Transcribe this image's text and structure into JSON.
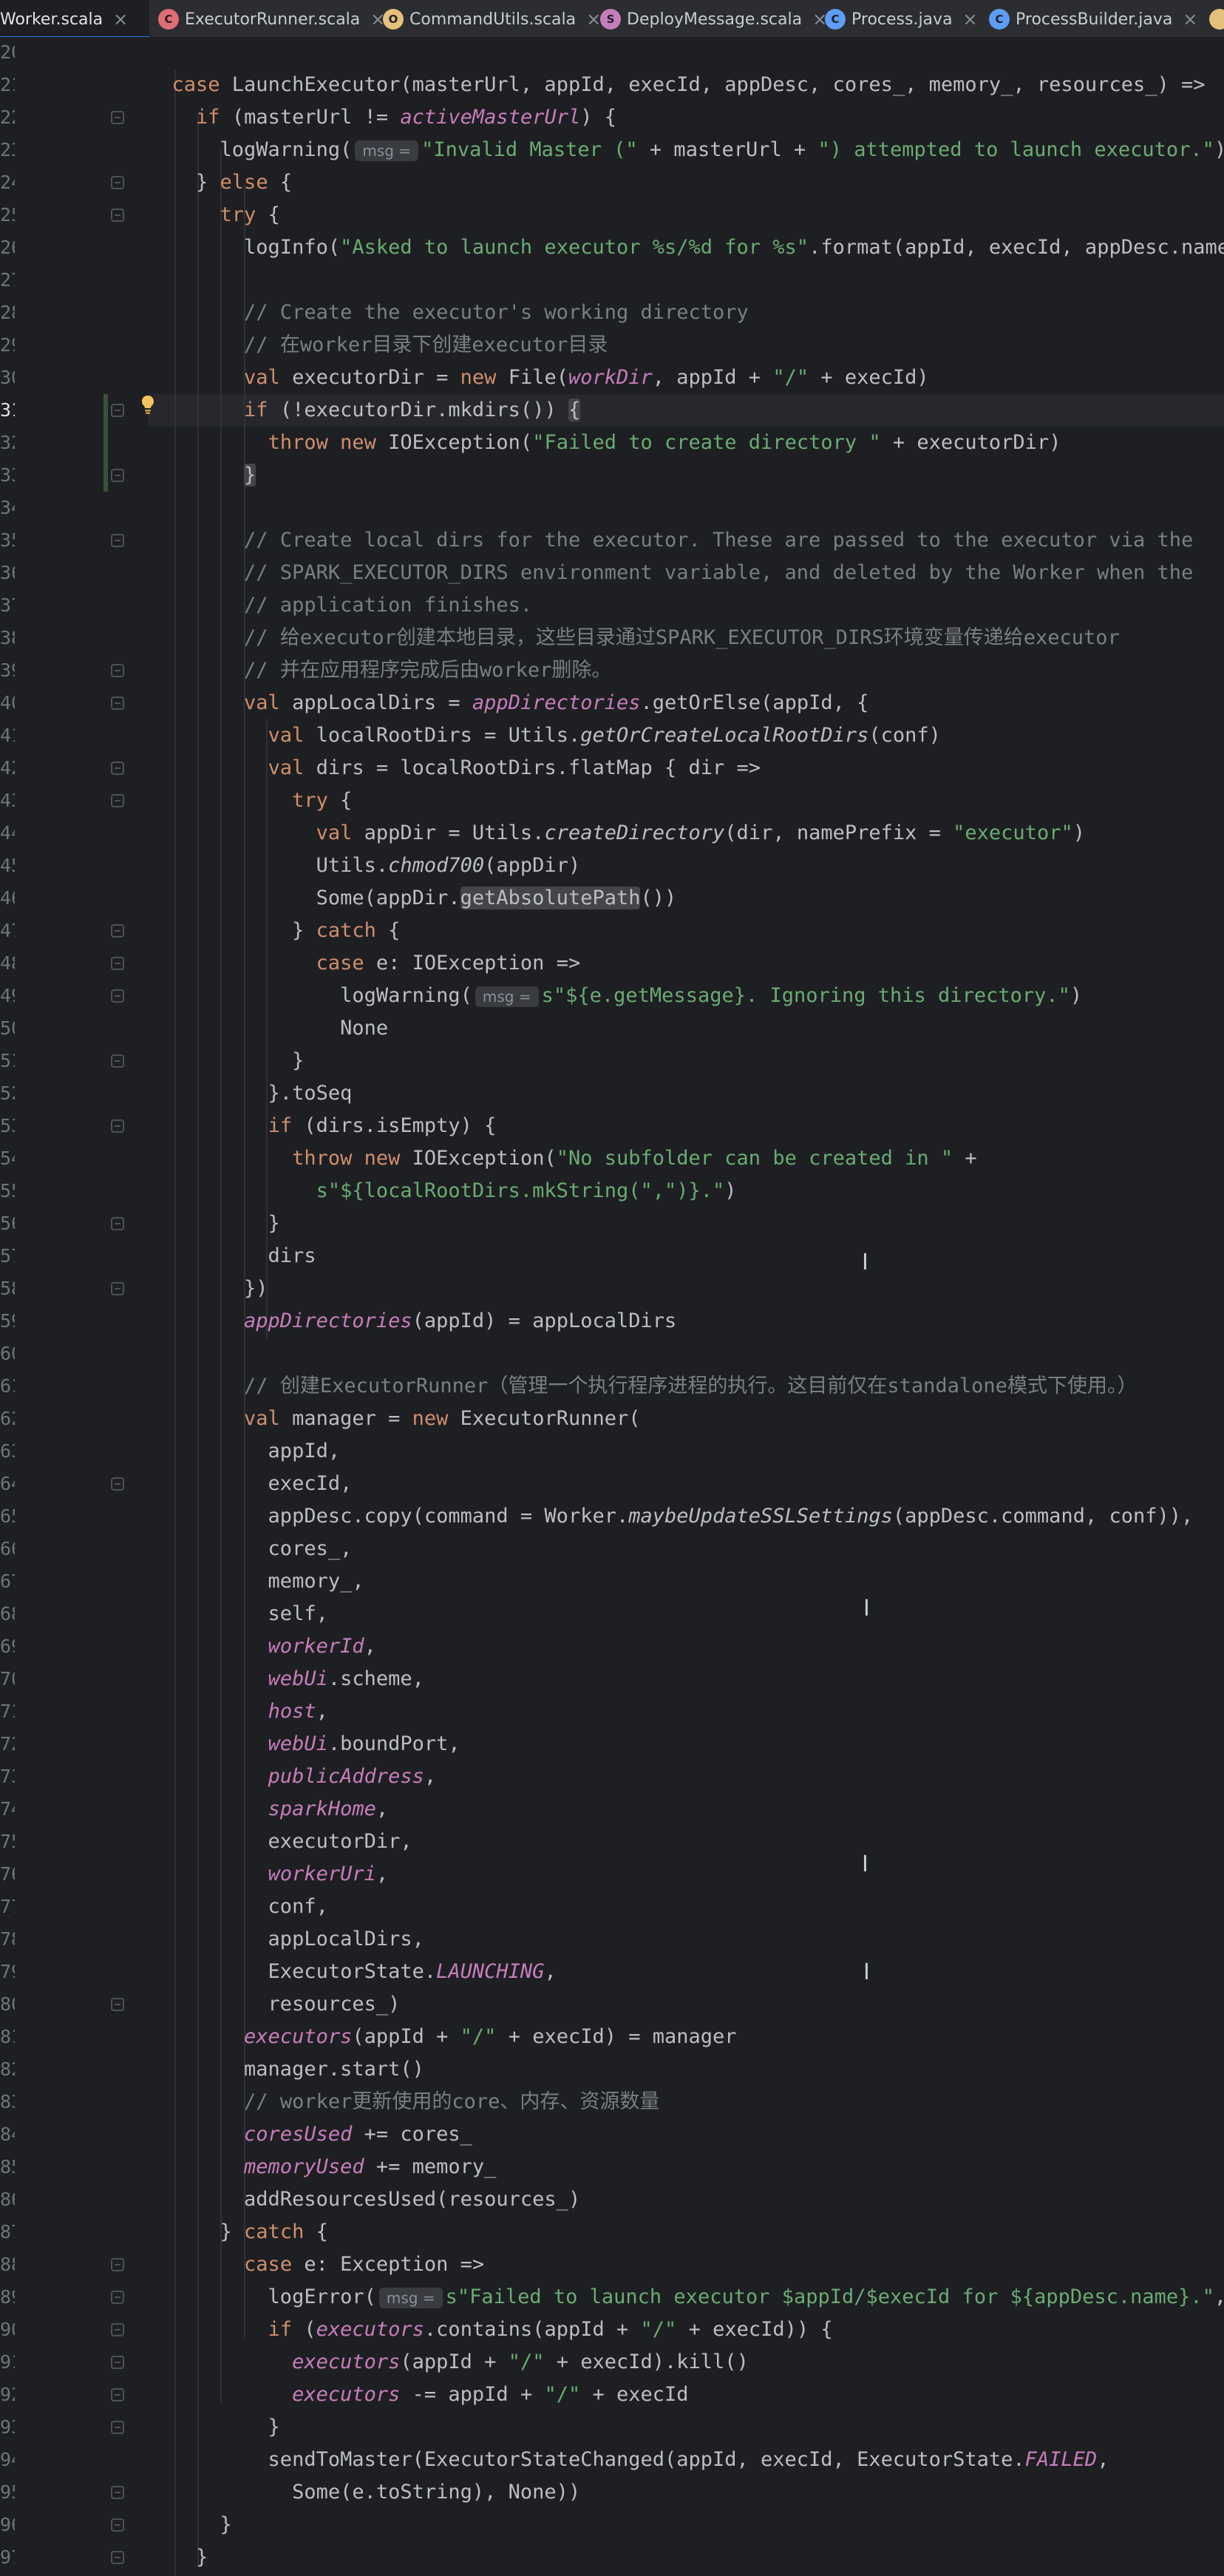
{
  "tabs": [
    {
      "label": "Worker.scala",
      "icon": "scala-object-icon",
      "color": "#e06c75",
      "active": true
    },
    {
      "label": "ExecutorRunner.scala",
      "icon": "scala-class-icon",
      "color": "#e06c75",
      "active": false
    },
    {
      "label": "CommandUtils.scala",
      "icon": "scala-object-icon",
      "color": "#e5c07b",
      "active": false
    },
    {
      "label": "DeployMessage.scala",
      "icon": "scala-file-icon",
      "color": "#c77dbb",
      "active": false
    },
    {
      "label": "Process.java",
      "icon": "java-class-icon",
      "color": "#5e9cf5",
      "active": false
    },
    {
      "label": "ProcessBuilder.java",
      "icon": "java-class-icon",
      "color": "#5e9cf5",
      "active": false
    }
  ],
  "line_numbers": [
    "20",
    "21",
    "22",
    "23",
    "24",
    "25",
    "26",
    "27",
    "28",
    "29",
    "30",
    "31",
    "32",
    "33",
    "34",
    "35",
    "36",
    "37",
    "38",
    "39",
    "40",
    "41",
    "42",
    "43",
    "44",
    "45",
    "46",
    "47",
    "48",
    "49",
    "50",
    "51",
    "52",
    "53",
    "54",
    "55",
    "56",
    "57",
    "58",
    "59",
    "60",
    "61",
    "62",
    "63",
    "64",
    "65",
    "66",
    "67",
    "68",
    "69",
    "70",
    "71",
    "72",
    "73",
    "74",
    "75",
    "76",
    "77",
    "78",
    "79",
    "80",
    "81",
    "82",
    "83",
    "84",
    "85",
    "86",
    "87",
    "88",
    "89",
    "90",
    "91",
    "92",
    "93",
    "94",
    "95",
    "96",
    "97",
    "98",
    "99",
    "00",
    "01",
    "02",
    "03",
    "04",
    "05",
    "06",
    "07",
    "08",
    "09",
    "10",
    "11",
    "12",
    "13",
    "14",
    "15",
    "16",
    "17",
    "18",
    "19",
    "20",
    "21",
    "22",
    "23",
    "24",
    "25",
    "26",
    "27",
    "28",
    "29",
    "30",
    "31",
    "32",
    "33",
    "34",
    "35",
    "36",
    "37",
    "38",
    "39",
    "40",
    "41",
    "42",
    "43",
    "44",
    "45",
    "46",
    "47",
    "48",
    "49",
    "50",
    "51",
    "52",
    "53",
    "54",
    "55",
    "56",
    "57",
    "58",
    "59",
    "60",
    "61",
    "62",
    "63",
    "64",
    "65",
    "66",
    "67",
    "68",
    "69",
    "70",
    "71",
    "72",
    "73",
    "74",
    "75",
    "76",
    "77",
    "78",
    "79",
    "80",
    "81",
    "82",
    "83",
    "84",
    "85",
    "86",
    "87",
    "88",
    "89",
    "90",
    "91",
    "92",
    "93",
    "94",
    "95",
    "96",
    "97"
  ],
  "editor": {
    "current_line": 11,
    "hint_label": "msg =",
    "lines": [
      [],
      [
        {
          "t": "  "
        },
        {
          "t": "case ",
          "c": "k"
        },
        {
          "t": "LaunchExecutor(masterUrl, appId, execId, appDesc, cores_, memory_, resources_) =>"
        }
      ],
      [
        {
          "t": "    "
        },
        {
          "t": "if ",
          "c": "k"
        },
        {
          "t": "(masterUrl != "
        },
        {
          "t": "activeMasterUrl",
          "c": "f"
        },
        {
          "t": ") {"
        }
      ],
      [
        {
          "t": "      logWarning("
        },
        {
          "hint": true
        },
        {
          "t": "\"Invalid Master (\" ",
          "c": "s"
        },
        {
          "t": "+ masterUrl + "
        },
        {
          "t": "\") attempted to launch executor.\"",
          "c": "s"
        },
        {
          "t": ")"
        }
      ],
      [
        {
          "t": "    } "
        },
        {
          "t": "else ",
          "c": "k"
        },
        {
          "t": "{"
        }
      ],
      [
        {
          "t": "      "
        },
        {
          "t": "try ",
          "c": "k"
        },
        {
          "t": "{"
        }
      ],
      [
        {
          "t": "        logInfo("
        },
        {
          "t": "\"Asked to launch executor %s/%d for %s\"",
          "c": "s"
        },
        {
          "t": ".format(appId, execId, appDesc.name))"
        }
      ],
      [],
      [
        {
          "t": "        "
        },
        {
          "t": "// Create the executor's working directory",
          "c": "c"
        }
      ],
      [
        {
          "t": "        "
        },
        {
          "t": "// 在worker目录下创建executor目录",
          "c": "c"
        }
      ],
      [
        {
          "t": "        "
        },
        {
          "t": "val ",
          "c": "k"
        },
        {
          "t": "executorDir = "
        },
        {
          "t": "new ",
          "c": "k"
        },
        {
          "t": "File("
        },
        {
          "t": "workDir",
          "c": "f"
        },
        {
          "t": ", appId + "
        },
        {
          "t": "\"/\" ",
          "c": "s"
        },
        {
          "t": "+ execId)"
        }
      ],
      [
        {
          "t": "        "
        },
        {
          "t": "if ",
          "c": "k"
        },
        {
          "t": "(!executorDir.mkdirs()) "
        },
        {
          "t": "{",
          "c": "h"
        }
      ],
      [
        {
          "t": "          "
        },
        {
          "t": "throw new ",
          "c": "k"
        },
        {
          "t": "IOException("
        },
        {
          "t": "\"Failed to create directory \" ",
          "c": "s"
        },
        {
          "t": "+ executorDir)"
        }
      ],
      [
        {
          "t": "        "
        },
        {
          "t": "}",
          "c": "h"
        }
      ],
      [],
      [
        {
          "t": "        "
        },
        {
          "t": "// Create local dirs for the executor. These are passed to the executor via the",
          "c": "c"
        }
      ],
      [
        {
          "t": "        "
        },
        {
          "t": "// SPARK_EXECUTOR_DIRS environment variable, and deleted by the Worker when the",
          "c": "c"
        }
      ],
      [
        {
          "t": "        "
        },
        {
          "t": "// application finishes.",
          "c": "c"
        }
      ],
      [
        {
          "t": "        "
        },
        {
          "t": "// 给executor创建本地目录，这些目录通过SPARK_EXECUTOR_DIRS环境变量传递给executor",
          "c": "c"
        }
      ],
      [
        {
          "t": "        "
        },
        {
          "t": "// 并在应用程序完成后由worker删除。",
          "c": "c"
        }
      ],
      [
        {
          "t": "        "
        },
        {
          "t": "val ",
          "c": "k"
        },
        {
          "t": "appLocalDirs = "
        },
        {
          "t": "appDirectories",
          "c": "f"
        },
        {
          "t": ".getOrElse(appId, {"
        }
      ],
      [
        {
          "t": "          "
        },
        {
          "t": "val ",
          "c": "k"
        },
        {
          "t": "localRootDirs = Utils."
        },
        {
          "t": "getOrCreateLocalRootDirs",
          "c": "i"
        },
        {
          "t": "(conf)"
        }
      ],
      [
        {
          "t": "          "
        },
        {
          "t": "val ",
          "c": "k"
        },
        {
          "t": "dirs = localRootDirs.flatMap { dir =>"
        }
      ],
      [
        {
          "t": "            "
        },
        {
          "t": "try ",
          "c": "k"
        },
        {
          "t": "{"
        }
      ],
      [
        {
          "t": "              "
        },
        {
          "t": "val ",
          "c": "k"
        },
        {
          "t": "appDir = Utils."
        },
        {
          "t": "createDirectory",
          "c": "i"
        },
        {
          "t": "(dir, namePrefix = "
        },
        {
          "t": "\"executor\"",
          "c": "s"
        },
        {
          "t": ")"
        }
      ],
      [
        {
          "t": "              Utils."
        },
        {
          "t": "chmod700",
          "c": "i"
        },
        {
          "t": "(appDir)"
        }
      ],
      [
        {
          "t": "              Some(appDir."
        },
        {
          "t": "getAbsolutePath",
          "c": "h"
        },
        {
          "t": "())"
        }
      ],
      [
        {
          "t": "            } "
        },
        {
          "t": "catch ",
          "c": "k"
        },
        {
          "t": "{"
        }
      ],
      [
        {
          "t": "              "
        },
        {
          "t": "case ",
          "c": "k"
        },
        {
          "t": "e: IOException =>"
        }
      ],
      [
        {
          "t": "                logWarning("
        },
        {
          "hint": true
        },
        {
          "t": "s\"${e.getMessage}. Ignoring this directory.\"",
          "c": "s"
        },
        {
          "t": ")"
        }
      ],
      [
        {
          "t": "                None"
        }
      ],
      [
        {
          "t": "            }"
        }
      ],
      [
        {
          "t": "          }.toSeq"
        }
      ],
      [
        {
          "t": "          "
        },
        {
          "t": "if ",
          "c": "k"
        },
        {
          "t": "(dirs.isEmpty) {"
        }
      ],
      [
        {
          "t": "            "
        },
        {
          "t": "throw new ",
          "c": "k"
        },
        {
          "t": "IOException("
        },
        {
          "t": "\"No subfolder can be created in \" ",
          "c": "s"
        },
        {
          "t": "+"
        }
      ],
      [
        {
          "t": "              "
        },
        {
          "t": "s\"${localRootDirs.mkString(\",\")}.\"",
          "c": "s"
        },
        {
          "t": ")"
        }
      ],
      [
        {
          "t": "          }"
        }
      ],
      [
        {
          "t": "          dirs"
        }
      ],
      [
        {
          "t": "        })"
        }
      ],
      [
        {
          "t": "        "
        },
        {
          "t": "appDirectories",
          "c": "f"
        },
        {
          "t": "(appId) = appLocalDirs"
        }
      ],
      [],
      [
        {
          "t": "        "
        },
        {
          "t": "// 创建ExecutorRunner（管理一个执行程序进程的执行。这目前仅在standalone模式下使用。）",
          "c": "c"
        }
      ],
      [
        {
          "t": "        "
        },
        {
          "t": "val ",
          "c": "k"
        },
        {
          "t": "manager = "
        },
        {
          "t": "new ",
          "c": "k"
        },
        {
          "t": "ExecutorRunner("
        }
      ],
      [
        {
          "t": "          appId,"
        }
      ],
      [
        {
          "t": "          execId,"
        }
      ],
      [
        {
          "t": "          appDesc.copy(command = Worker."
        },
        {
          "t": "maybeUpdateSSLSettings",
          "c": "i"
        },
        {
          "t": "(appDesc.command, conf)),"
        }
      ],
      [
        {
          "t": "          cores_,"
        }
      ],
      [
        {
          "t": "          memory_,"
        }
      ],
      [
        {
          "t": "          self,"
        }
      ],
      [
        {
          "t": "          "
        },
        {
          "t": "workerId",
          "c": "f"
        },
        {
          "t": ","
        }
      ],
      [
        {
          "t": "          "
        },
        {
          "t": "webUi",
          "c": "f"
        },
        {
          "t": ".scheme,"
        }
      ],
      [
        {
          "t": "          "
        },
        {
          "t": "host",
          "c": "f"
        },
        {
          "t": ","
        }
      ],
      [
        {
          "t": "          "
        },
        {
          "t": "webUi",
          "c": "f"
        },
        {
          "t": ".boundPort,"
        }
      ],
      [
        {
          "t": "          "
        },
        {
          "t": "publicAddress",
          "c": "f"
        },
        {
          "t": ","
        }
      ],
      [
        {
          "t": "          "
        },
        {
          "t": "sparkHome",
          "c": "f"
        },
        {
          "t": ","
        }
      ],
      [
        {
          "t": "          executorDir,"
        }
      ],
      [
        {
          "t": "          "
        },
        {
          "t": "workerUri",
          "c": "f"
        },
        {
          "t": ","
        }
      ],
      [
        {
          "t": "          conf,"
        }
      ],
      [
        {
          "t": "          appLocalDirs,"
        }
      ],
      [
        {
          "t": "          ExecutorState."
        },
        {
          "t": "LAUNCHING",
          "c": "f"
        },
        {
          "t": ","
        }
      ],
      [
        {
          "t": "          resources_)"
        }
      ],
      [
        {
          "t": "        "
        },
        {
          "t": "executors",
          "c": "f"
        },
        {
          "t": "(appId + "
        },
        {
          "t": "\"/\" ",
          "c": "s"
        },
        {
          "t": "+ execId) = manager"
        }
      ],
      [
        {
          "t": "        manager.start()"
        }
      ],
      [
        {
          "t": "        "
        },
        {
          "t": "// worker更新使用的core、内存、资源数量",
          "c": "c"
        }
      ],
      [
        {
          "t": "        "
        },
        {
          "t": "coresUsed",
          "c": "f"
        },
        {
          "t": " += cores_"
        }
      ],
      [
        {
          "t": "        "
        },
        {
          "t": "memoryUsed",
          "c": "f"
        },
        {
          "t": " += memory_"
        }
      ],
      [
        {
          "t": "        addResourcesUsed(resources_)"
        }
      ],
      [
        {
          "t": "      } "
        },
        {
          "t": "catch ",
          "c": "k"
        },
        {
          "t": "{"
        }
      ],
      [
        {
          "t": "        "
        },
        {
          "t": "case ",
          "c": "k"
        },
        {
          "t": "e: Exception =>"
        }
      ],
      [
        {
          "t": "          logError("
        },
        {
          "hint": true
        },
        {
          "t": "s\"Failed to launch executor $appId/$execId for ${appDesc.name}.\"",
          "c": "s"
        },
        {
          "t": ", e)"
        }
      ],
      [
        {
          "t": "          "
        },
        {
          "t": "if ",
          "c": "k"
        },
        {
          "t": "("
        },
        {
          "t": "executors",
          "c": "f"
        },
        {
          "t": ".contains(appId + "
        },
        {
          "t": "\"/\" ",
          "c": "s"
        },
        {
          "t": "+ execId)) {"
        }
      ],
      [
        {
          "t": "            "
        },
        {
          "t": "executors",
          "c": "f"
        },
        {
          "t": "(appId + "
        },
        {
          "t": "\"/\" ",
          "c": "s"
        },
        {
          "t": "+ execId).kill()"
        }
      ],
      [
        {
          "t": "            "
        },
        {
          "t": "executors",
          "c": "f"
        },
        {
          "t": " -= appId + "
        },
        {
          "t": "\"/\" ",
          "c": "s"
        },
        {
          "t": "+ execId"
        }
      ],
      [
        {
          "t": "          }"
        }
      ],
      [
        {
          "t": "          sendToMaster(ExecutorStateChanged(appId, execId, ExecutorState."
        },
        {
          "t": "FAILED",
          "c": "f"
        },
        {
          "t": ","
        }
      ],
      [
        {
          "t": "            Some(e.toString), None))"
        }
      ],
      [
        {
          "t": "      }"
        }
      ],
      [
        {
          "t": "    }"
        }
      ]
    ]
  }
}
